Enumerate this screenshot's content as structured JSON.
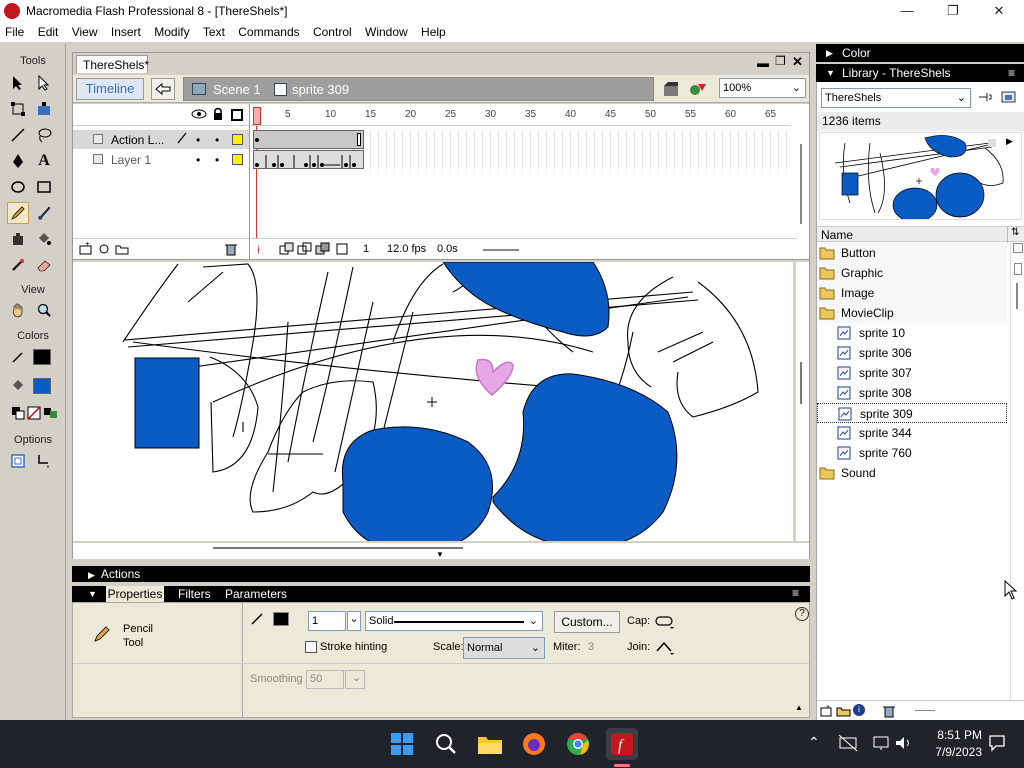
{
  "window": {
    "title": "Macromedia Flash Professional 8 - [ThereShels*]",
    "min": "—",
    "max": "❐",
    "close": "✕"
  },
  "menu": [
    "File",
    "Edit",
    "View",
    "Insert",
    "Modify",
    "Text",
    "Commands",
    "Control",
    "Window",
    "Help"
  ],
  "tools": {
    "heading": "Tools",
    "view_heading": "View",
    "colors_heading": "Colors",
    "options_heading": "Options",
    "stroke_color": "#000000",
    "fill_color": "#0a5bc4"
  },
  "document": {
    "tab": "ThereShels*",
    "timeline_button": "Timeline",
    "scene": "Scene 1",
    "symbol": "sprite 309",
    "zoom": "100%"
  },
  "timeline": {
    "layers": [
      {
        "name": "Action L...",
        "selected": true
      },
      {
        "name": "Layer 1",
        "selected": false
      }
    ],
    "frame_numbers": [
      "1",
      "5",
      "10",
      "15",
      "20",
      "25",
      "30",
      "35",
      "40",
      "45",
      "50",
      "55",
      "60",
      "65"
    ],
    "current_frame": "1",
    "fps": "12.0 fps",
    "time": "0.0s"
  },
  "panels": {
    "actions": "Actions",
    "properties_tabs": [
      "Properties",
      "Filters",
      "Parameters"
    ]
  },
  "properties": {
    "tool_name_1": "Pencil",
    "tool_name_2": "Tool",
    "stroke_width": "1",
    "stroke_style": "Solid",
    "custom_button": "Custom...",
    "cap_label": "Cap:",
    "stroke_hinting": "Stroke hinting",
    "scale_label": "Scale:",
    "scale_value": "Normal",
    "miter_label": "Miter:",
    "miter_value": "3",
    "join_label": "Join:",
    "smoothing_label": "Smoothing",
    "smoothing_value": "50"
  },
  "color_panel": {
    "title": "Color"
  },
  "library": {
    "title": "Library - ThereShels",
    "document_select": "ThereShels",
    "item_count": "1236 items",
    "column_name": "Name",
    "items": [
      {
        "name": "Button",
        "type": "folder",
        "indent": false,
        "selected": false
      },
      {
        "name": "Graphic",
        "type": "folder",
        "indent": false,
        "selected": false
      },
      {
        "name": "Image",
        "type": "folder",
        "indent": false,
        "selected": false
      },
      {
        "name": "MovieClip",
        "type": "folder-open",
        "indent": false,
        "selected": false
      },
      {
        "name": "sprite 10",
        "type": "movieclip",
        "indent": true,
        "selected": false
      },
      {
        "name": "sprite 306",
        "type": "movieclip",
        "indent": true,
        "selected": false
      },
      {
        "name": "sprite 307",
        "type": "movieclip",
        "indent": true,
        "selected": false
      },
      {
        "name": "sprite 308",
        "type": "movieclip",
        "indent": true,
        "selected": false
      },
      {
        "name": "sprite 309",
        "type": "movieclip",
        "indent": true,
        "selected": true
      },
      {
        "name": "sprite 344",
        "type": "movieclip",
        "indent": true,
        "selected": false
      },
      {
        "name": "sprite 760",
        "type": "movieclip",
        "indent": true,
        "selected": false
      },
      {
        "name": "Sound",
        "type": "folder",
        "indent": false,
        "selected": false
      }
    ]
  },
  "taskbar": {
    "time": "8:51 PM",
    "date": "7/9/2023"
  },
  "colors": {
    "shape_blue": "#0a5bc4",
    "heart_pink": "#e7a7e6",
    "timeline_red": "#d9534f"
  }
}
